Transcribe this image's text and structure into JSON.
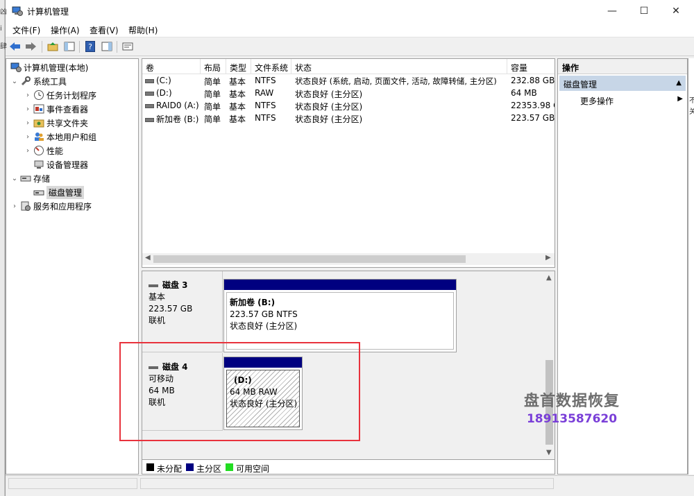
{
  "window": {
    "title": "计算机管理"
  },
  "left_strip": [
    "凶",
    "i",
    "肆"
  ],
  "menu": [
    "文件(F)",
    "操作(A)",
    "查看(V)",
    "帮助(H)"
  ],
  "tree": {
    "root": "计算机管理(本地)",
    "system_tools": "系统工具",
    "task_scheduler": "任务计划程序",
    "event_viewer": "事件查看器",
    "shared_folders": "共享文件夹",
    "local_users": "本地用户和组",
    "performance": "性能",
    "device_manager": "设备管理器",
    "storage": "存储",
    "disk_management": "磁盘管理",
    "services_apps": "服务和应用程序"
  },
  "volume_table": {
    "columns": [
      "卷",
      "布局",
      "类型",
      "文件系统",
      "状态",
      "容量"
    ],
    "rows": [
      {
        "volume": "(C:)",
        "layout": "简单",
        "type": "基本",
        "fs": "NTFS",
        "status": "状态良好 (系统, 启动, 页面文件, 活动, 故障转储, 主分区)",
        "capacity": "232.88 GB"
      },
      {
        "volume": "(D:)",
        "layout": "简单",
        "type": "基本",
        "fs": "RAW",
        "status": "状态良好 (主分区)",
        "capacity": "64 MB"
      },
      {
        "volume": "RAID0 (A:)",
        "layout": "简单",
        "type": "基本",
        "fs": "NTFS",
        "status": "状态良好 (主分区)",
        "capacity": "22353.98 G"
      },
      {
        "volume": "新加卷 (B:)",
        "layout": "简单",
        "type": "基本",
        "fs": "NTFS",
        "status": "状态良好 (主分区)",
        "capacity": "223.57 GB"
      }
    ]
  },
  "disks": [
    {
      "name": "磁盘 3",
      "kind": "基本",
      "size": "223.57 GB",
      "state": "联机",
      "partition": {
        "name": "新加卷  (B:)",
        "detail": "223.57 GB NTFS",
        "status": "状态良好 (主分区)"
      }
    },
    {
      "name": "磁盘 4",
      "kind": "可移动",
      "size": "64 MB",
      "state": "联机",
      "partition": {
        "name": "(D:)",
        "detail": "64 MB RAW",
        "status": "状态良好 (主分区)"
      }
    }
  ],
  "legend": [
    {
      "label": "未分配",
      "color": "#000000"
    },
    {
      "label": "主分区",
      "color": "#000080"
    },
    {
      "label": "可用空间",
      "color": "#22dd22"
    }
  ],
  "actions": {
    "header": "操作",
    "section": "磁盘管理",
    "more": "更多操作"
  },
  "right_edge": [
    "不",
    "关"
  ],
  "watermark": {
    "line1": "盘首数据恢复",
    "line2": "18913587620"
  },
  "colors": {
    "partition_bar": "#000080",
    "selection": "#c7d6e7",
    "highlight_box": "#e8323c"
  }
}
